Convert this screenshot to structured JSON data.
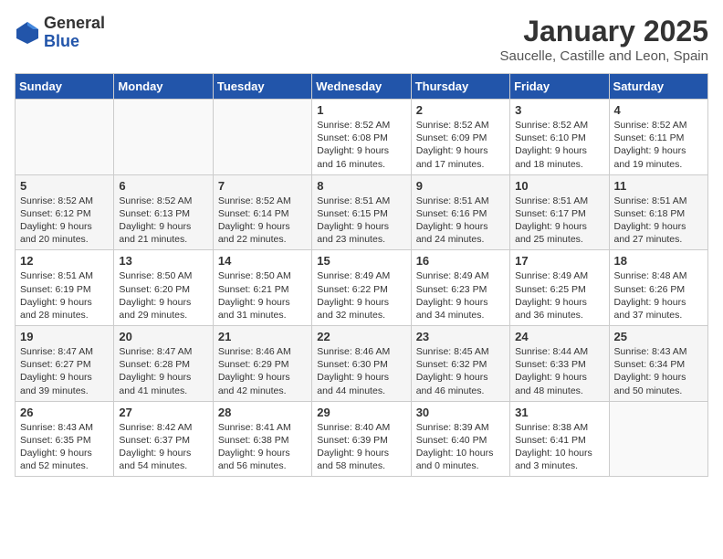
{
  "header": {
    "logo_general": "General",
    "logo_blue": "Blue",
    "title": "January 2025",
    "subtitle": "Saucelle, Castille and Leon, Spain"
  },
  "days_of_week": [
    "Sunday",
    "Monday",
    "Tuesday",
    "Wednesday",
    "Thursday",
    "Friday",
    "Saturday"
  ],
  "weeks": [
    [
      {
        "day": "",
        "text": ""
      },
      {
        "day": "",
        "text": ""
      },
      {
        "day": "",
        "text": ""
      },
      {
        "day": "1",
        "text": "Sunrise: 8:52 AM\nSunset: 6:08 PM\nDaylight: 9 hours and 16 minutes."
      },
      {
        "day": "2",
        "text": "Sunrise: 8:52 AM\nSunset: 6:09 PM\nDaylight: 9 hours and 17 minutes."
      },
      {
        "day": "3",
        "text": "Sunrise: 8:52 AM\nSunset: 6:10 PM\nDaylight: 9 hours and 18 minutes."
      },
      {
        "day": "4",
        "text": "Sunrise: 8:52 AM\nSunset: 6:11 PM\nDaylight: 9 hours and 19 minutes."
      }
    ],
    [
      {
        "day": "5",
        "text": "Sunrise: 8:52 AM\nSunset: 6:12 PM\nDaylight: 9 hours and 20 minutes."
      },
      {
        "day": "6",
        "text": "Sunrise: 8:52 AM\nSunset: 6:13 PM\nDaylight: 9 hours and 21 minutes."
      },
      {
        "day": "7",
        "text": "Sunrise: 8:52 AM\nSunset: 6:14 PM\nDaylight: 9 hours and 22 minutes."
      },
      {
        "day": "8",
        "text": "Sunrise: 8:51 AM\nSunset: 6:15 PM\nDaylight: 9 hours and 23 minutes."
      },
      {
        "day": "9",
        "text": "Sunrise: 8:51 AM\nSunset: 6:16 PM\nDaylight: 9 hours and 24 minutes."
      },
      {
        "day": "10",
        "text": "Sunrise: 8:51 AM\nSunset: 6:17 PM\nDaylight: 9 hours and 25 minutes."
      },
      {
        "day": "11",
        "text": "Sunrise: 8:51 AM\nSunset: 6:18 PM\nDaylight: 9 hours and 27 minutes."
      }
    ],
    [
      {
        "day": "12",
        "text": "Sunrise: 8:51 AM\nSunset: 6:19 PM\nDaylight: 9 hours and 28 minutes."
      },
      {
        "day": "13",
        "text": "Sunrise: 8:50 AM\nSunset: 6:20 PM\nDaylight: 9 hours and 29 minutes."
      },
      {
        "day": "14",
        "text": "Sunrise: 8:50 AM\nSunset: 6:21 PM\nDaylight: 9 hours and 31 minutes."
      },
      {
        "day": "15",
        "text": "Sunrise: 8:49 AM\nSunset: 6:22 PM\nDaylight: 9 hours and 32 minutes."
      },
      {
        "day": "16",
        "text": "Sunrise: 8:49 AM\nSunset: 6:23 PM\nDaylight: 9 hours and 34 minutes."
      },
      {
        "day": "17",
        "text": "Sunrise: 8:49 AM\nSunset: 6:25 PM\nDaylight: 9 hours and 36 minutes."
      },
      {
        "day": "18",
        "text": "Sunrise: 8:48 AM\nSunset: 6:26 PM\nDaylight: 9 hours and 37 minutes."
      }
    ],
    [
      {
        "day": "19",
        "text": "Sunrise: 8:47 AM\nSunset: 6:27 PM\nDaylight: 9 hours and 39 minutes."
      },
      {
        "day": "20",
        "text": "Sunrise: 8:47 AM\nSunset: 6:28 PM\nDaylight: 9 hours and 41 minutes."
      },
      {
        "day": "21",
        "text": "Sunrise: 8:46 AM\nSunset: 6:29 PM\nDaylight: 9 hours and 42 minutes."
      },
      {
        "day": "22",
        "text": "Sunrise: 8:46 AM\nSunset: 6:30 PM\nDaylight: 9 hours and 44 minutes."
      },
      {
        "day": "23",
        "text": "Sunrise: 8:45 AM\nSunset: 6:32 PM\nDaylight: 9 hours and 46 minutes."
      },
      {
        "day": "24",
        "text": "Sunrise: 8:44 AM\nSunset: 6:33 PM\nDaylight: 9 hours and 48 minutes."
      },
      {
        "day": "25",
        "text": "Sunrise: 8:43 AM\nSunset: 6:34 PM\nDaylight: 9 hours and 50 minutes."
      }
    ],
    [
      {
        "day": "26",
        "text": "Sunrise: 8:43 AM\nSunset: 6:35 PM\nDaylight: 9 hours and 52 minutes."
      },
      {
        "day": "27",
        "text": "Sunrise: 8:42 AM\nSunset: 6:37 PM\nDaylight: 9 hours and 54 minutes."
      },
      {
        "day": "28",
        "text": "Sunrise: 8:41 AM\nSunset: 6:38 PM\nDaylight: 9 hours and 56 minutes."
      },
      {
        "day": "29",
        "text": "Sunrise: 8:40 AM\nSunset: 6:39 PM\nDaylight: 9 hours and 58 minutes."
      },
      {
        "day": "30",
        "text": "Sunrise: 8:39 AM\nSunset: 6:40 PM\nDaylight: 10 hours and 0 minutes."
      },
      {
        "day": "31",
        "text": "Sunrise: 8:38 AM\nSunset: 6:41 PM\nDaylight: 10 hours and 3 minutes."
      },
      {
        "day": "",
        "text": ""
      }
    ]
  ]
}
